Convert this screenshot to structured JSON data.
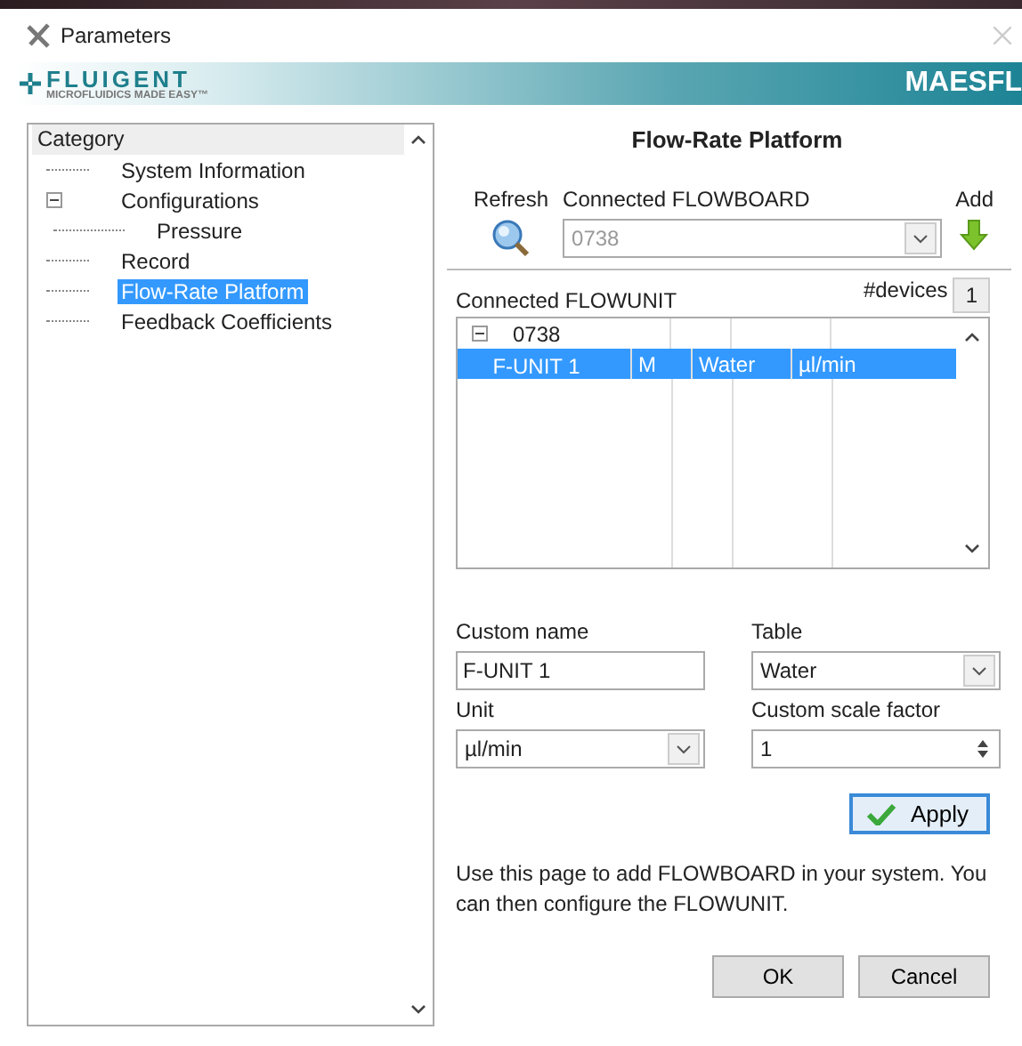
{
  "window": {
    "title": "Parameters"
  },
  "banner": {
    "logo": "FLUIGENT",
    "tagline": "MICROFLUIDICS MADE EASY™",
    "product": "MAESFL"
  },
  "category_tree": {
    "header": "Category",
    "items": [
      {
        "label": "System Information",
        "selected": false
      },
      {
        "label": "Configurations",
        "selected": false,
        "expanded": true,
        "children": [
          {
            "label": "Pressure",
            "selected": false
          }
        ]
      },
      {
        "label": "Record",
        "selected": false
      },
      {
        "label": "Flow-Rate Platform",
        "selected": true
      },
      {
        "label": "Feedback Coefficients",
        "selected": false
      }
    ]
  },
  "page": {
    "title": "Flow-Rate Platform",
    "refresh_label": "Refresh",
    "flowboard_label": "Connected FLOWBOARD",
    "flowboard_value": "0738",
    "flowboard_disabled": true,
    "add_label": "Add",
    "flowunit_label": "Connected FLOWUNIT",
    "devices_label": "#devices",
    "devices_value": "1",
    "device_groups": [
      {
        "name": "0738",
        "expanded": true,
        "rows": [
          {
            "cells": [
              "F-UNIT 1",
              "M",
              "Water",
              "µl/min"
            ],
            "selected": true
          }
        ]
      }
    ],
    "custom_name_label": "Custom name",
    "custom_name_value": "F-UNIT 1",
    "table_label": "Table",
    "table_value": "Water",
    "unit_label": "Unit",
    "unit_value": "µl/min",
    "scale_label": "Custom scale factor",
    "scale_value": "1",
    "apply_button": "Apply",
    "help_text": "Use this page to add FLOWBOARD in your system. You can then configure the FLOWUNIT."
  },
  "buttons": [
    "OK",
    "Cancel"
  ]
}
